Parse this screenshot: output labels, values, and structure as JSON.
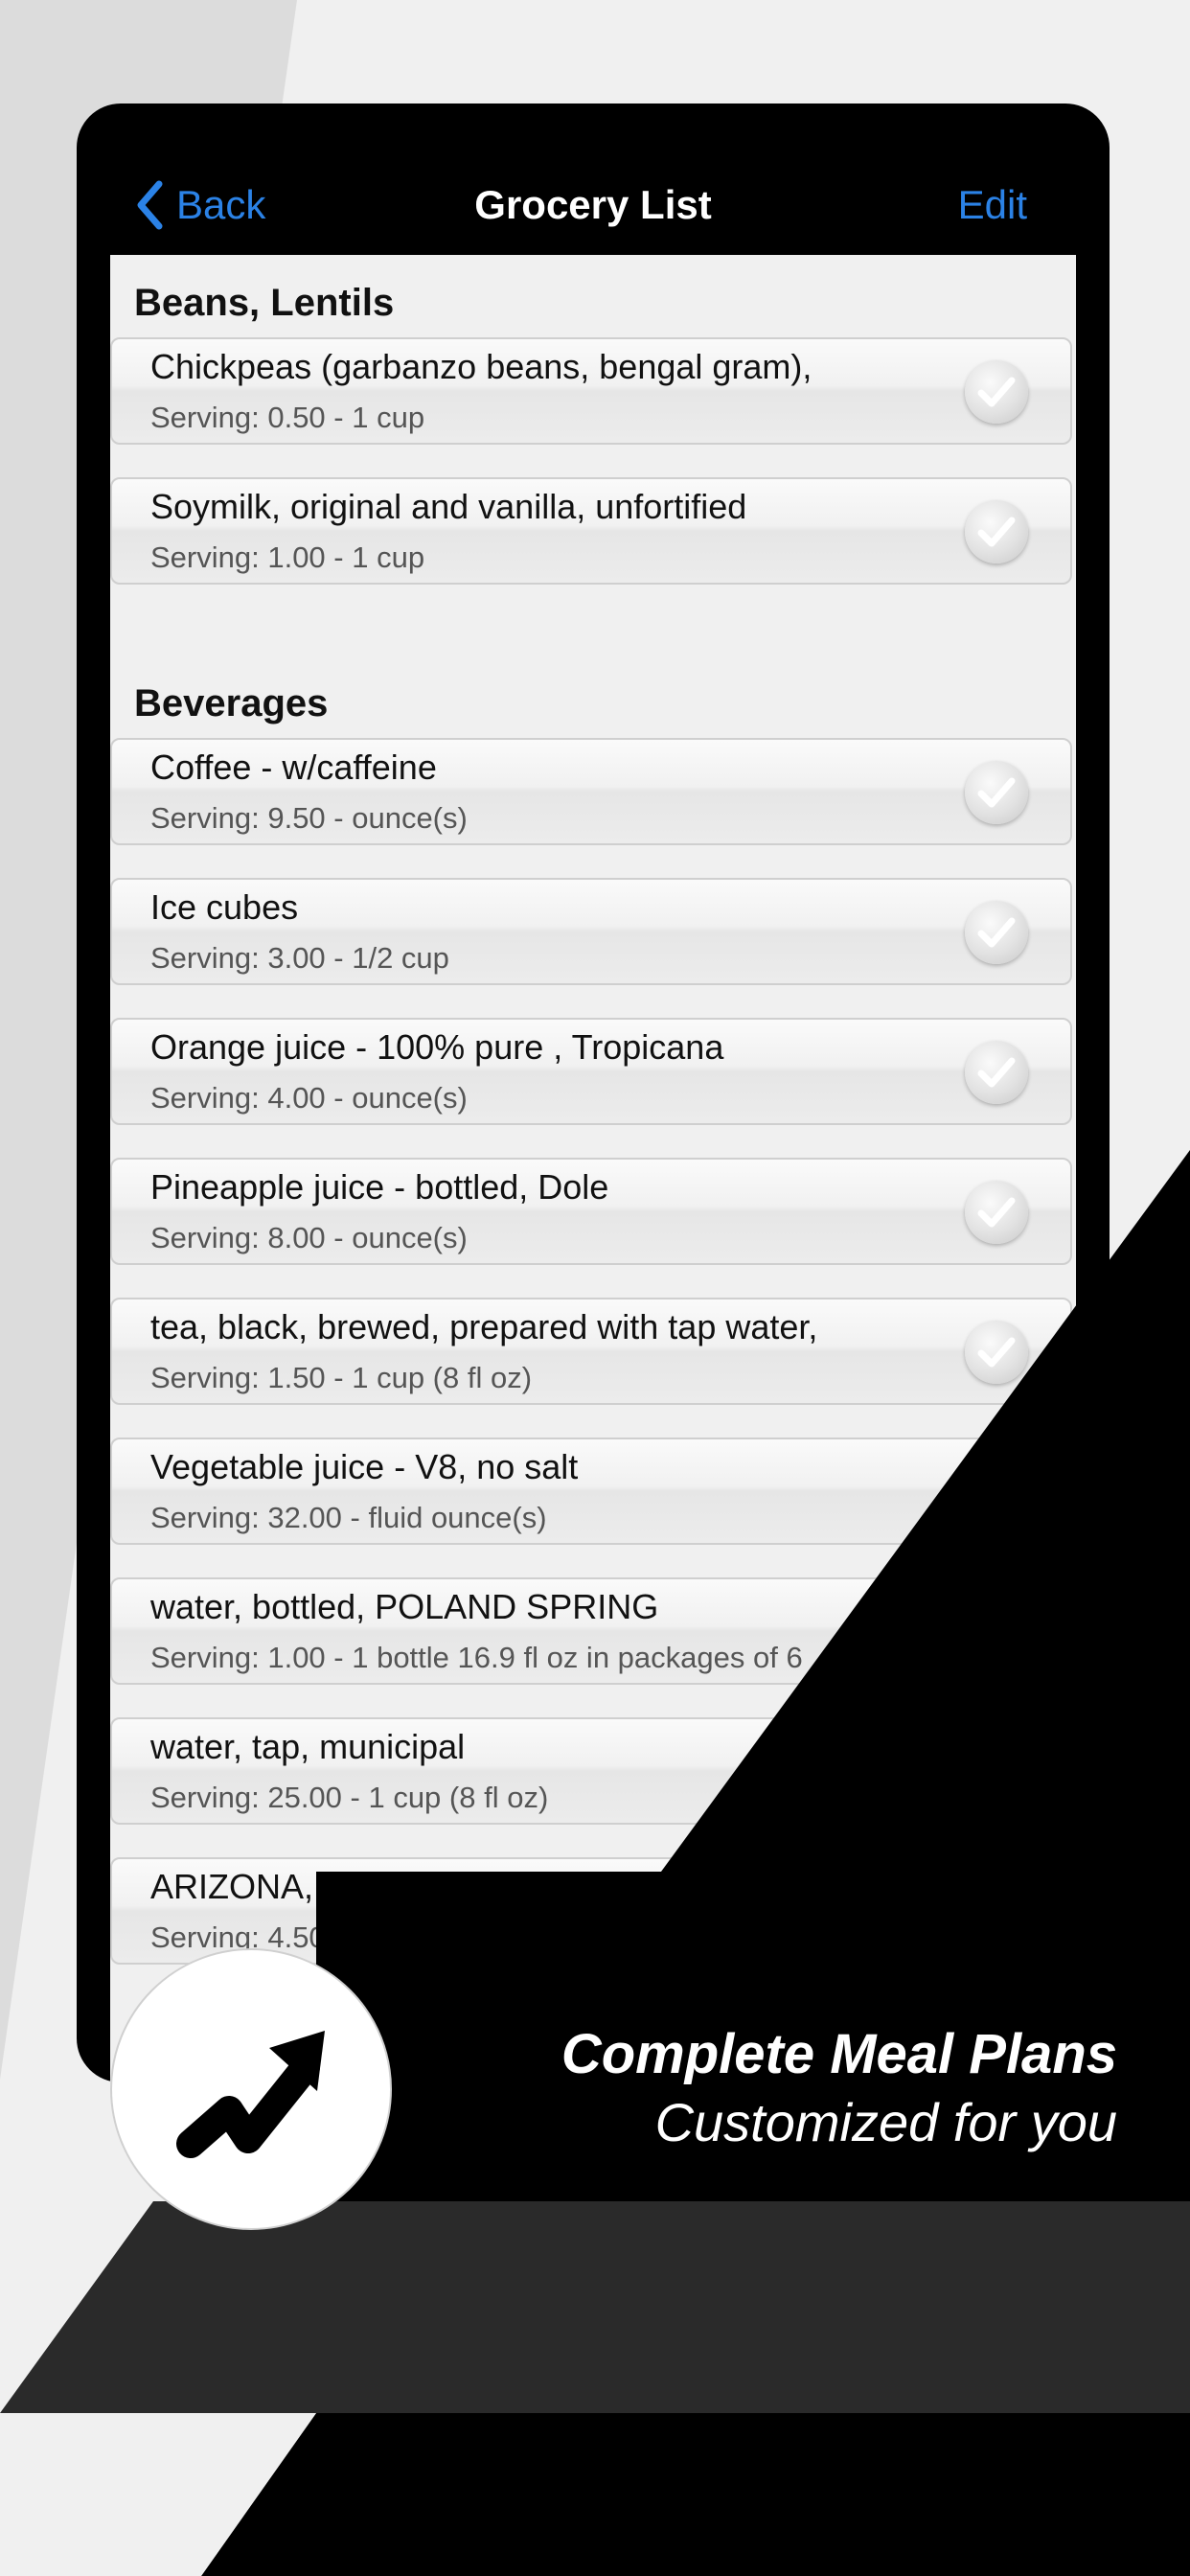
{
  "nav": {
    "back_label": "Back",
    "title": "Grocery List",
    "edit_label": "Edit"
  },
  "sections": [
    {
      "header": "Beans, Lentils",
      "items": [
        {
          "name": "Chickpeas (garbanzo beans, bengal gram),",
          "serving": "Serving: 0.50 - 1 cup"
        },
        {
          "name": "Soymilk, original and vanilla, unfortified",
          "serving": "Serving: 1.00 - 1 cup"
        }
      ]
    },
    {
      "header": "Beverages",
      "items": [
        {
          "name": "Coffee - w/caffeine",
          "serving": "Serving: 9.50 - ounce(s)"
        },
        {
          "name": "Ice cubes",
          "serving": "Serving: 3.00 - 1/2 cup"
        },
        {
          "name": "Orange juice - 100% pure , Tropicana",
          "serving": "Serving: 4.00 - ounce(s)"
        },
        {
          "name": "Pineapple juice - bottled, Dole",
          "serving": "Serving: 8.00 - ounce(s)"
        },
        {
          "name": "tea, black, brewed, prepared with tap water,",
          "serving": "Serving: 1.50 - 1 cup (8 fl oz)"
        },
        {
          "name": "Vegetable juice - V8, no salt",
          "serving": "Serving: 32.00 - fluid ounce(s)"
        },
        {
          "name": "water, bottled, POLAND SPRING",
          "serving": "Serving: 1.00 - 1 bottle 16.9 fl oz in packages of 6"
        },
        {
          "name": "water, tap, municipal",
          "serving": "Serving: 25.00 - 1 cup (8 fl oz)"
        },
        {
          "name": "ARIZONA, tea, ready-to-drink, lem",
          "serving": "Serving: 4.50"
        }
      ]
    }
  ],
  "promo": {
    "title": "Complete Meal Plans",
    "subtitle": "Customized for you"
  },
  "icons": {
    "back": "chevron-left-icon",
    "check": "checkmark-icon",
    "logo": "trend-arrow-icon"
  },
  "colors": {
    "accent": "#2b82e6",
    "background": "#f0f0f0",
    "dark": "#000000",
    "band": "#2a2a2a"
  }
}
